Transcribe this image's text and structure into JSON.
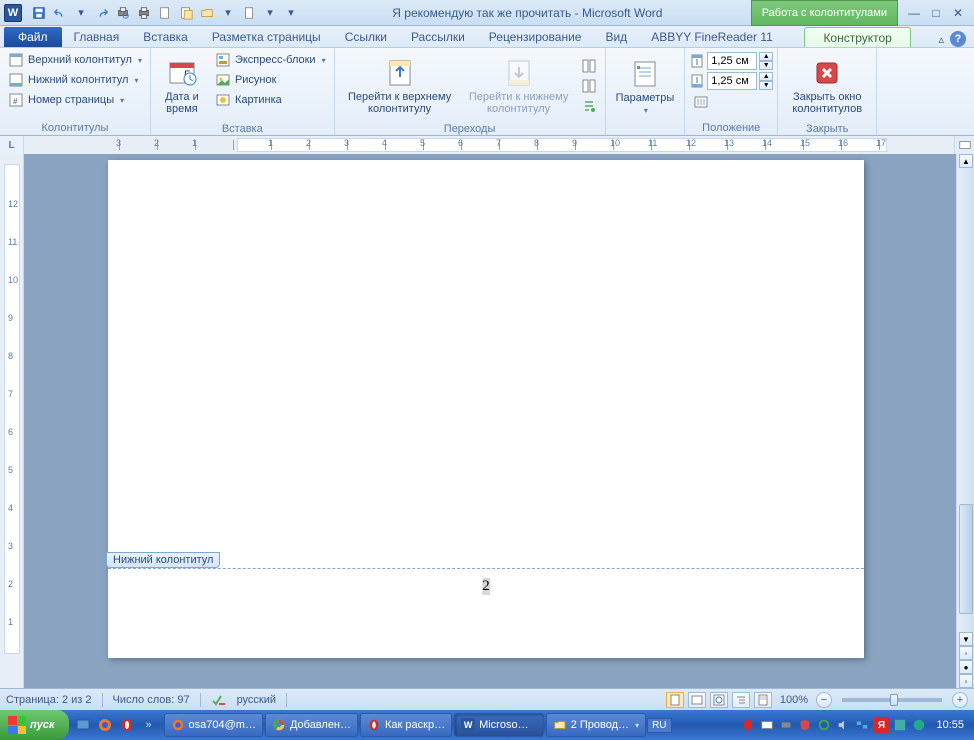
{
  "title": {
    "doc": "Я рекомендую так же прочитать",
    "app": "Microsoft Word"
  },
  "contextual_tab_title": "Работа с колонтитулами",
  "tabs": {
    "file": "Файл",
    "items": [
      "Главная",
      "Вставка",
      "Разметка страницы",
      "Ссылки",
      "Рассылки",
      "Рецензирование",
      "Вид",
      "ABBYY FineReader 11"
    ],
    "context": "Конструктор"
  },
  "ribbon": {
    "g1": {
      "label": "Колонтитулы",
      "header": "Верхний колонтитул",
      "footer": "Нижний колонтитул",
      "pagenum": "Номер страницы"
    },
    "g2": {
      "label": "Вставка",
      "datetime": "Дата и время",
      "quick": "Экспресс-блоки",
      "pic": "Рисунок",
      "clip": "Картинка"
    },
    "g3": {
      "label": "Переходы",
      "gotoheader": "Перейти к верхнему колонтитулу",
      "gotofooter": "Перейти к нижнему колонтитулу"
    },
    "g4": {
      "label": "",
      "params": "Параметры"
    },
    "g5": {
      "label": "Положение",
      "top": "1,25 см",
      "bottom": "1,25 см"
    },
    "g6": {
      "label": "Закрыть",
      "close": "Закрыть окно колонтитулов"
    }
  },
  "document": {
    "footer_tab": "Нижний колонтитул",
    "page_number": "2"
  },
  "status": {
    "page": "Страница: 2 из 2",
    "words": "Число слов: 97",
    "lang": "русский",
    "zoom": "100%"
  },
  "taskbar": {
    "start": "пуск",
    "items": [
      {
        "label": "osa704@m…",
        "icon": "firefox"
      },
      {
        "label": "Добавлен…",
        "icon": "chrome"
      },
      {
        "label": "Как раскр…",
        "icon": "opera"
      },
      {
        "label": "Microso…",
        "icon": "word",
        "active": true
      },
      {
        "label": "2 Провод…",
        "icon": "folder",
        "dd": true
      }
    ],
    "lang": "RU",
    "clock": "10:55"
  }
}
